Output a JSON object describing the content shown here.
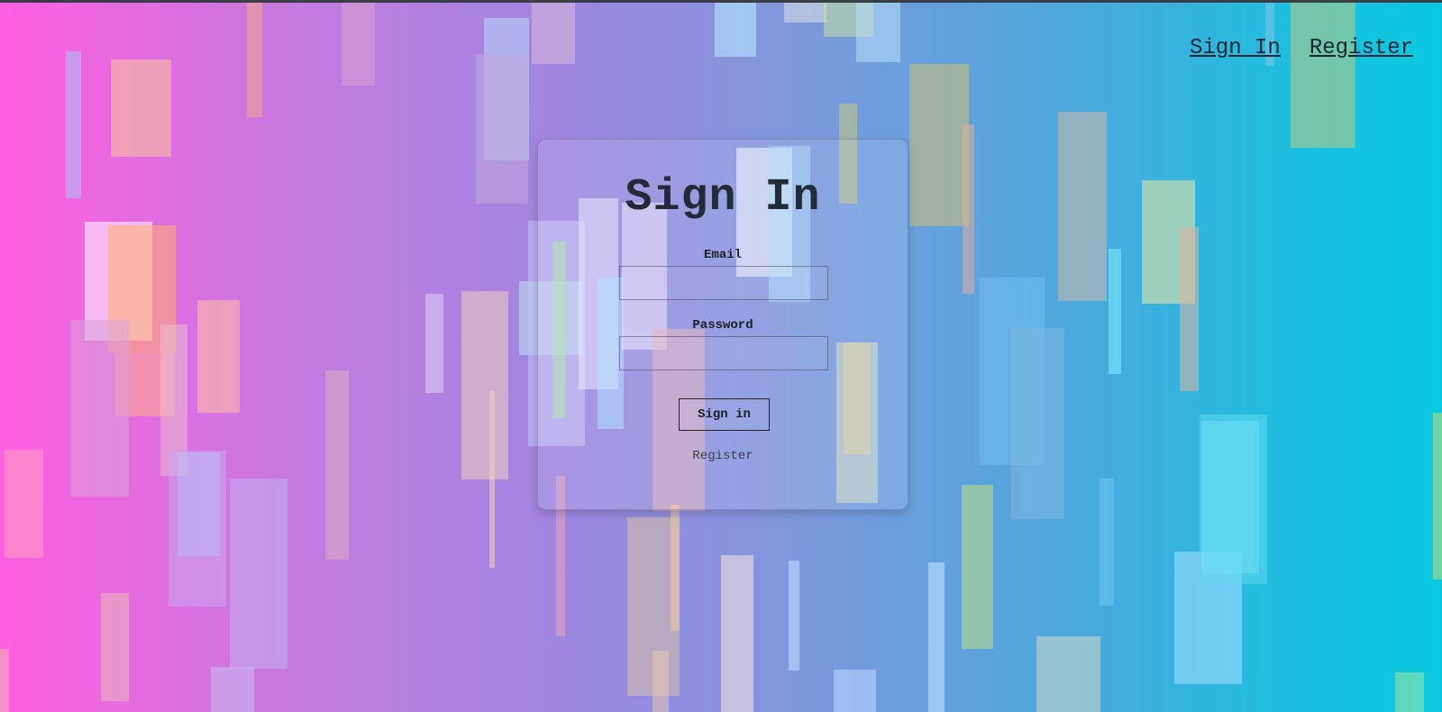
{
  "nav": {
    "links": [
      "Sign In",
      "Register"
    ]
  },
  "form": {
    "title": "Sign In",
    "email_label": "Email",
    "email_value": "",
    "password_label": "Password",
    "password_value": "",
    "submit_label": "Sign in",
    "register_link": "Register"
  },
  "colors": {
    "gradient_left": "#ff5fe2",
    "gradient_right": "#0bc8e0",
    "text_dark": "#222b36"
  }
}
